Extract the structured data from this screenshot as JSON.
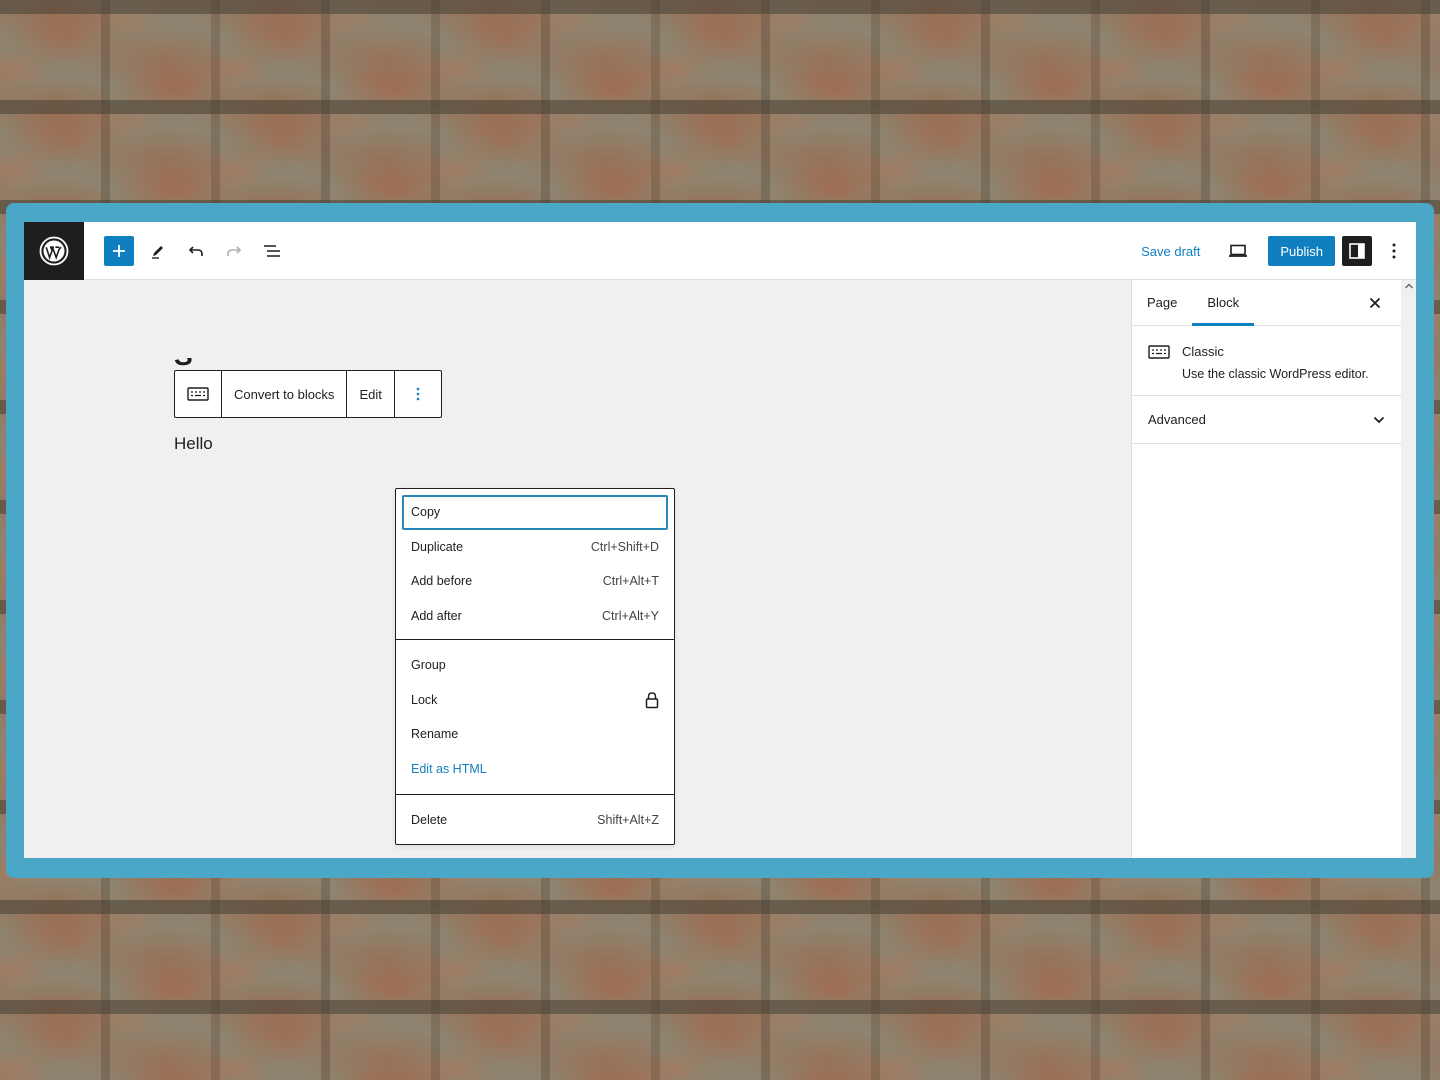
{
  "header": {
    "save_draft_label": "Save draft",
    "publish_label": "Publish"
  },
  "canvas": {
    "title_fragment": "S",
    "paragraph_text": "Hello"
  },
  "block_toolbar": {
    "convert_label": "Convert to blocks",
    "edit_label": "Edit"
  },
  "dropdown": {
    "groups": [
      [
        {
          "label": "Copy",
          "shortcut": ""
        },
        {
          "label": "Duplicate",
          "shortcut": "Ctrl+Shift+D"
        },
        {
          "label": "Add before",
          "shortcut": "Ctrl+Alt+T"
        },
        {
          "label": "Add after",
          "shortcut": "Ctrl+Alt+Y"
        }
      ],
      [
        {
          "label": "Group",
          "shortcut": ""
        },
        {
          "label": "Lock",
          "shortcut": ""
        },
        {
          "label": "Rename",
          "shortcut": ""
        },
        {
          "label": "Edit as HTML",
          "shortcut": ""
        }
      ],
      [
        {
          "label": "Delete",
          "shortcut": "Shift+Alt+Z"
        }
      ]
    ]
  },
  "sidebar": {
    "tabs": [
      "Page",
      "Block"
    ],
    "active_tab": "Block",
    "block_name": "Classic",
    "block_description": "Use the classic WordPress editor.",
    "advanced_label": "Advanced"
  },
  "colors": {
    "accent": "#0f7fc0",
    "frame": "#4aa7c8",
    "dark": "#1e1e1e"
  },
  "icons": {
    "logo": "wordpress-logo-icon",
    "inserter": "plus-icon",
    "tools": "pencil-icon",
    "undo": "undo-icon",
    "redo": "redo-icon",
    "list_view": "list-view-icon",
    "preview": "laptop-icon",
    "settings": "sidebar-toggle-icon",
    "options": "more-vertical-icon",
    "classic_block": "keyboard-icon",
    "lock": "lock-icon",
    "close": "close-icon",
    "chevron": "chevron-down-icon"
  }
}
